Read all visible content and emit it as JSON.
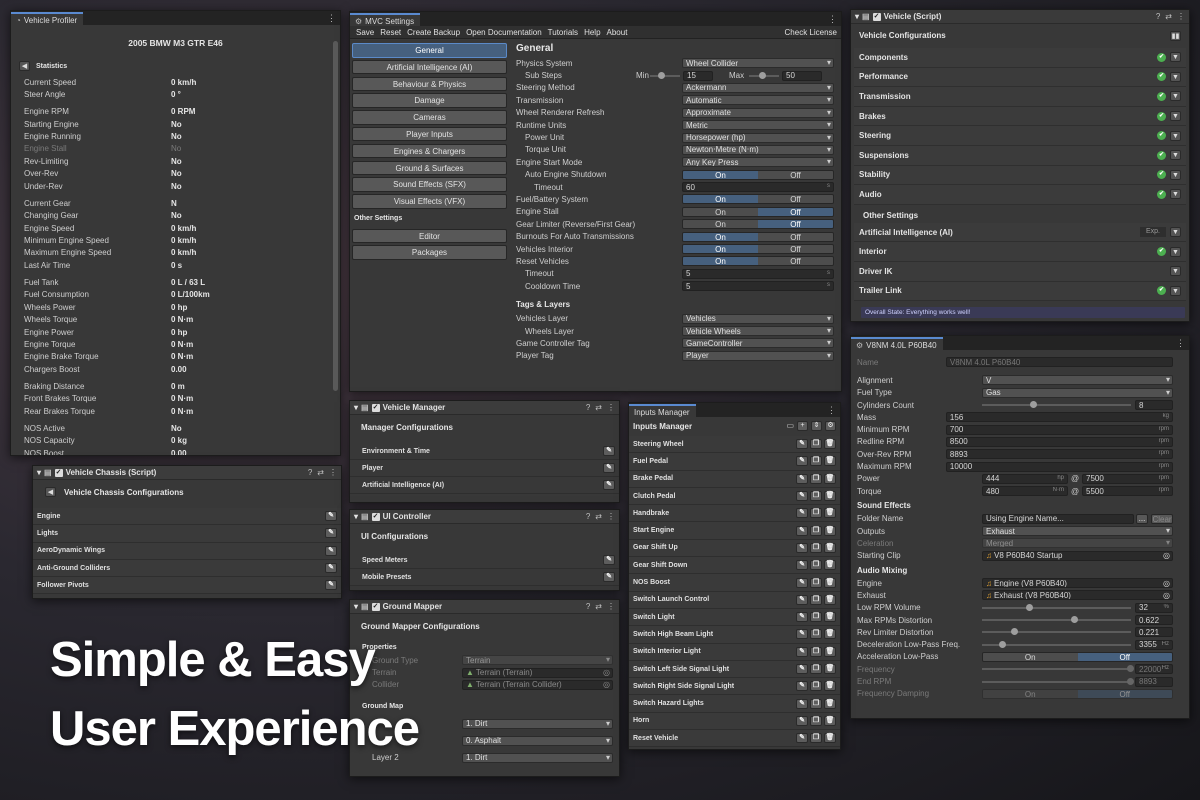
{
  "headline": {
    "line1": "Simple & Easy",
    "line2": "User Experience"
  },
  "profiler": {
    "tab": "Vehicle Profiler",
    "vehicle_name": "2005 BMW M3 GTR E46",
    "back_label": "Statistics",
    "groups": [
      [
        {
          "label": "Current Speed",
          "value": "0 km/h"
        },
        {
          "label": "Steer Angle",
          "value": "0 °"
        }
      ],
      [
        {
          "label": "Engine RPM",
          "value": "0 RPM"
        },
        {
          "label": "Starting Engine",
          "value": "No"
        },
        {
          "label": "Engine Running",
          "value": "No"
        },
        {
          "label": "Engine Stall",
          "value": "No",
          "dim": true
        },
        {
          "label": "Rev-Limiting",
          "value": "No"
        },
        {
          "label": "Over-Rev",
          "value": "No"
        },
        {
          "label": "Under-Rev",
          "value": "No"
        }
      ],
      [
        {
          "label": "Current Gear",
          "value": "N"
        },
        {
          "label": "Changing Gear",
          "value": "No"
        },
        {
          "label": "Engine Speed",
          "value": "0 km/h"
        },
        {
          "label": "Minimum Engine Speed",
          "value": "0 km/h"
        },
        {
          "label": "Maximum Engine Speed",
          "value": "0 km/h"
        },
        {
          "label": "Last Air Time",
          "value": "0 s"
        }
      ],
      [
        {
          "label": "Fuel Tank",
          "value": "0 L / 63 L"
        },
        {
          "label": "Fuel Consumption",
          "value": "0 L/100km"
        },
        {
          "label": "Wheels Power",
          "value": "0 hp"
        },
        {
          "label": "Wheels Torque",
          "value": "0 N·m"
        },
        {
          "label": "Engine Power",
          "value": "0 hp"
        },
        {
          "label": "Engine Torque",
          "value": "0 N·m"
        },
        {
          "label": "Engine Brake Torque",
          "value": "0 N·m"
        },
        {
          "label": "Chargers Boost",
          "value": "0.00"
        }
      ],
      [
        {
          "label": "Braking Distance",
          "value": "0 m"
        },
        {
          "label": "Front Brakes Torque",
          "value": "0 N·m"
        },
        {
          "label": "Rear Brakes Torque",
          "value": "0 N·m"
        }
      ],
      [
        {
          "label": "NOS Active",
          "value": "No"
        },
        {
          "label": "NOS Capacity",
          "value": "0 kg"
        },
        {
          "label": "NOS Boost",
          "value": "0.00"
        }
      ]
    ]
  },
  "mvc": {
    "tab": "MVC Settings",
    "menu": [
      "Save",
      "Reset",
      "Create Backup",
      "Open Documentation",
      "Tutorials",
      "Help",
      "About"
    ],
    "check_license": "Check License",
    "nav": [
      "General",
      "Artificial Intelligence (AI)",
      "Behaviour & Physics",
      "Damage",
      "Cameras",
      "Player Inputs",
      "Engines & Chargers",
      "Ground & Surfaces",
      "Sound Effects (SFX)",
      "Visual Effects (VFX)"
    ],
    "other_settings": "Other Settings",
    "nav2": [
      "Editor",
      "Packages"
    ],
    "section_title": "General",
    "physics_system": {
      "label": "Physics System",
      "value": "Wheel Collider"
    },
    "sub_steps": {
      "label": "Sub Steps",
      "min_label": "Min",
      "min": "15",
      "max_label": "Max",
      "max": "50"
    },
    "rows": [
      {
        "label": "Steering Method",
        "type": "drop",
        "value": "Ackermann"
      },
      {
        "label": "Transmission",
        "type": "drop",
        "value": "Automatic"
      },
      {
        "label": "Wheel Renderer Refresh",
        "type": "drop",
        "value": "Approximate"
      },
      {
        "label": "Runtime Units",
        "type": "drop",
        "value": "Metric"
      },
      {
        "label": "Power Unit",
        "type": "drop",
        "value": "Horsepower (hp)",
        "indent": 1
      },
      {
        "label": "Torque Unit",
        "type": "drop",
        "value": "Newton⋅Metre (N⋅m)",
        "indent": 1
      },
      {
        "label": "Engine Start Mode",
        "type": "drop",
        "value": "Any Key Press"
      },
      {
        "label": "Auto Engine Shutdown",
        "type": "tog",
        "on": true,
        "indent": 1
      },
      {
        "label": "Timeout",
        "type": "field",
        "value": "60",
        "unit": "s",
        "indent": 2
      },
      {
        "label": "Fuel/Battery System",
        "type": "tog",
        "on": true
      },
      {
        "label": "Engine Stall",
        "type": "tog",
        "on": false
      },
      {
        "label": "Gear Limiter (Reverse/First Gear)",
        "type": "tog",
        "on": false
      },
      {
        "label": "Burnouts For Auto Transmissions",
        "type": "tog",
        "on": true
      },
      {
        "label": "Vehicles Interior",
        "type": "tog",
        "on": true
      },
      {
        "label": "Reset Vehicles",
        "type": "tog",
        "on": true
      },
      {
        "label": "Timeout",
        "type": "field",
        "value": "5",
        "unit": "s",
        "indent": 1
      },
      {
        "label": "Cooldown Time",
        "type": "field",
        "value": "5",
        "unit": "s",
        "indent": 1
      }
    ],
    "on_label": "On",
    "off_label": "Off",
    "tags_title": "Tags & Layers",
    "tags": [
      {
        "label": "Vehicles Layer",
        "value": "Vehicles"
      },
      {
        "label": "Wheels Layer",
        "value": "Vehicle Wheels",
        "indent": 1
      },
      {
        "label": "Game Controller Tag",
        "value": "GameController"
      },
      {
        "label": "Player Tag",
        "value": "Player"
      }
    ]
  },
  "vconfig": {
    "tab": "Vehicle (Script)",
    "title": "Vehicle Configurations",
    "items": [
      "Components",
      "Performance",
      "Transmission",
      "Brakes",
      "Steering",
      "Suspensions",
      "Stability",
      "Audio"
    ],
    "other_title": "Other Settings",
    "other": [
      {
        "label": "Artificial Intelligence (AI)",
        "extra": "Exp.",
        "check": false
      },
      {
        "label": "Interior",
        "check": true
      },
      {
        "label": "Driver IK",
        "check": false
      },
      {
        "label": "Trailer Link",
        "check": true
      }
    ],
    "status": "Overall State: Everything works well!"
  },
  "engine": {
    "tab": "V8NM 4.0L P60B40",
    "name": {
      "label": "Name",
      "value": "V8NM 4.0L P60B40"
    },
    "alignment": {
      "label": "Alignment",
      "value": "V"
    },
    "fuel": {
      "label": "Fuel Type",
      "value": "Gas"
    },
    "cylinders": {
      "label": "Cylinders Count",
      "value": "8"
    },
    "mass": {
      "label": "Mass",
      "value": "156",
      "unit": "kg"
    },
    "min_rpm": {
      "label": "Minimum RPM",
      "value": "700",
      "unit": "rpm"
    },
    "red_rpm": {
      "label": "Redline RPM",
      "value": "8500",
      "unit": "rpm"
    },
    "over_rpm": {
      "label": "Over-Rev RPM",
      "value": "8893",
      "unit": "rpm"
    },
    "max_rpm": {
      "label": "Maximum RPM",
      "value": "10000",
      "unit": "rpm"
    },
    "power": {
      "label": "Power",
      "value": "444",
      "unit": "hp",
      "at": "@",
      "rpm": "7500",
      "rpm_unit": "rpm"
    },
    "torque": {
      "label": "Torque",
      "value": "480",
      "unit": "N·m",
      "at": "@",
      "rpm": "5500",
      "rpm_unit": "rpm"
    },
    "sfx_title": "Sound Effects",
    "folder": {
      "label": "Folder Name",
      "value": "Using Engine Name...",
      "dots": "...",
      "clear": "Clear"
    },
    "outputs": {
      "label": "Outputs",
      "value": "Exhaust"
    },
    "celeration": {
      "label": "Celeration",
      "value": "Merged"
    },
    "start_clip": {
      "label": "Starting Clip",
      "value": "V8 P60B40 Startup"
    },
    "mix_title": "Audio Mixing",
    "mix_engine": {
      "label": "Engine",
      "value": "Engine (V8 P60B40)"
    },
    "mix_exhaust": {
      "label": "Exhaust",
      "value": "Exhaust (V8 P60B40)"
    },
    "low_rpm_vol": {
      "label": "Low RPM Volume",
      "value": "32",
      "unit": "%",
      "fraction": 0.32
    },
    "max_rpm_dist": {
      "label": "Max RPMs Distortion",
      "value": "0.622",
      "fraction": 0.622
    },
    "rev_dist": {
      "label": "Rev Limiter Distortion",
      "value": "0.221",
      "fraction": 0.221
    },
    "decel_lp": {
      "label": "Deceleration Low-Pass Freq.",
      "value": "3355",
      "unit": "Hz",
      "fraction": 0.14
    },
    "accel_lp": {
      "label": "Acceleration Low-Pass",
      "on": "On",
      "off": "Off"
    },
    "frequency": {
      "label": "Frequency",
      "value": "22000",
      "unit": "Hz",
      "fraction": 1.0
    },
    "end_rpm": {
      "label": "End RPM",
      "value": "8893",
      "fraction": 1.0
    },
    "freq_damp": {
      "label": "Frequency Damping",
      "on": "On",
      "off": "Off"
    }
  },
  "chassis": {
    "tab": "Vehicle Chassis (Script)",
    "title": "Vehicle Chassis Configurations",
    "items": [
      "Engine",
      "Lights",
      "AeroDynamic Wings",
      "Anti-Ground Colliders",
      "Follower Pivots"
    ]
  },
  "manager": {
    "tab": "Vehicle Manager",
    "title": "Manager Configurations",
    "items": [
      "Environment & Time",
      "Player",
      "Artificial Intelligence (AI)"
    ]
  },
  "uictrl": {
    "tab": "UI Controller",
    "title": "UI Configurations",
    "items": [
      "Speed Meters",
      "Mobile Presets"
    ]
  },
  "ground": {
    "tab": "Ground Mapper",
    "title": "Ground Mapper Configurations",
    "props_title": "Properties",
    "ground_type": {
      "label": "Ground Type",
      "value": "Terrain"
    },
    "terrain": {
      "label": "Terrain",
      "value": "Terrain (Terrain)"
    },
    "collider": {
      "label": "Collider",
      "value": "Terrain (Terrain Collider)"
    },
    "map_title": "Ground Map",
    "layers": [
      {
        "label": "",
        "value": "1. Dirt"
      },
      {
        "label": "",
        "value": "0. Asphalt"
      },
      {
        "label": "Layer 2",
        "value": "1. Dirt"
      }
    ]
  },
  "inputs": {
    "tab": "Inputs Manager",
    "title": "Inputs Manager",
    "items": [
      "Steering Wheel",
      "Fuel Pedal",
      "Brake Pedal",
      "Clutch Pedal",
      "Handbrake",
      "Start Engine",
      "Gear Shift Up",
      "Gear Shift Down",
      "NOS Boost",
      "Switch Launch Control",
      "Switch Light",
      "Switch High Beam Light",
      "Switch Interior Light",
      "Switch Left Side Signal Light",
      "Switch Right Side Signal Light",
      "Switch Hazard Lights",
      "Horn",
      "Reset Vehicle"
    ]
  }
}
